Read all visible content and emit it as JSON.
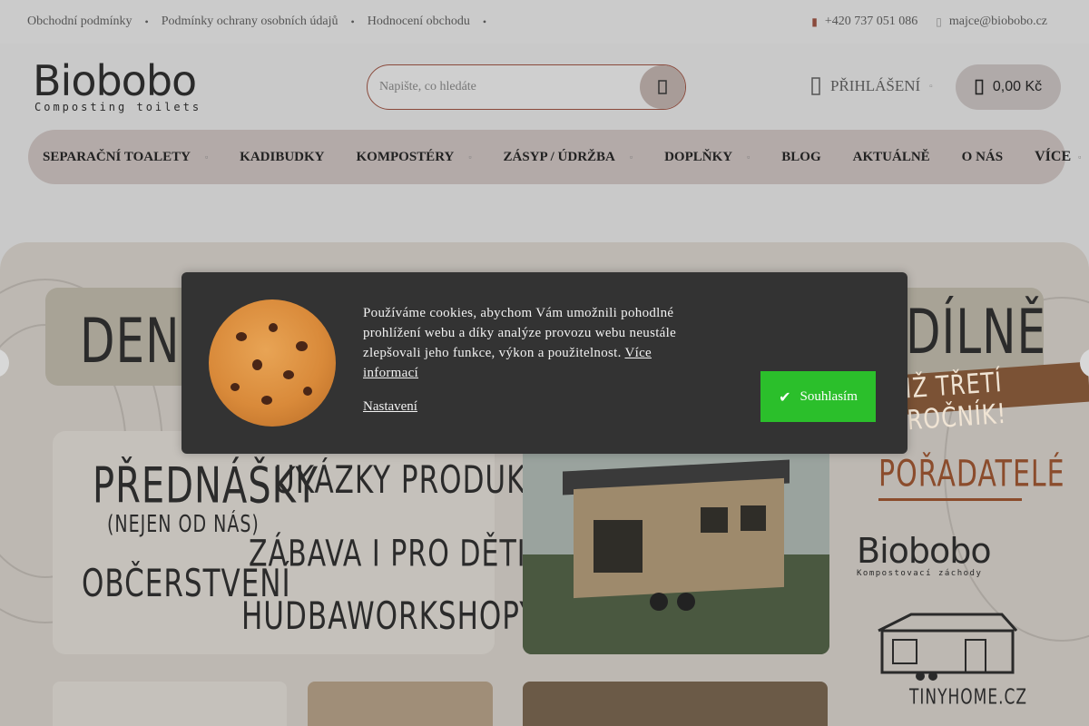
{
  "topbar": {
    "links": [
      "Obchodní podmínky",
      "Podmínky ochrany osobních údajů",
      "Hodnocení obchodu"
    ],
    "phone": "+420 737 051 086",
    "email": "majce@biobobo.cz"
  },
  "header": {
    "logo_word": "Biobobo",
    "logo_sub": "Composting toilets",
    "search_placeholder": "Napište, co hledáte",
    "login_label": "PŘIHLÁŠENÍ",
    "cart_total": "0,00 Kč"
  },
  "nav": {
    "items": [
      "SEPARAČNÍ TOALETY",
      "KADIBUDKY",
      "KOMPOSTÉRY",
      "ZÁSYP / ÚDRŽBA",
      "DOPLŇKY",
      "BLOG",
      "AKTUÁLNĚ",
      "O NÁS"
    ],
    "more": "VÍCE"
  },
  "banner": {
    "title_left": "DEN O",
    "title_right": "DÍLNĚ",
    "ribbon": "IŽ TŘETÍ ROČNÍK!",
    "lines": {
      "lectures": "PŘEDNÁŠKY",
      "not_only": "(NEJEN OD NÁS)",
      "products": "UKÁZKY PRODUKTŮ",
      "fun": "ZÁBAVA I PRO DĚTI",
      "snacks": "OBČERSTVENÍ",
      "music": "HUDBA",
      "workshops": "WORKSHOPY"
    },
    "organizers": "POŘADATELÉ",
    "brand": "Biobobo",
    "brand_sub": "Kompostovací záchody",
    "tinyhome": "TINYHOME.CZ"
  },
  "cookie": {
    "text": "Používáme cookies, abychom Vám umožnili pohodlné prohlížení webu a díky analýze provozu webu neustále zlepšovali jeho funkce, výkon a použitelnost. ",
    "more_link": "Více informací",
    "settings": "Nastavení",
    "accept": "Souhlasím"
  }
}
